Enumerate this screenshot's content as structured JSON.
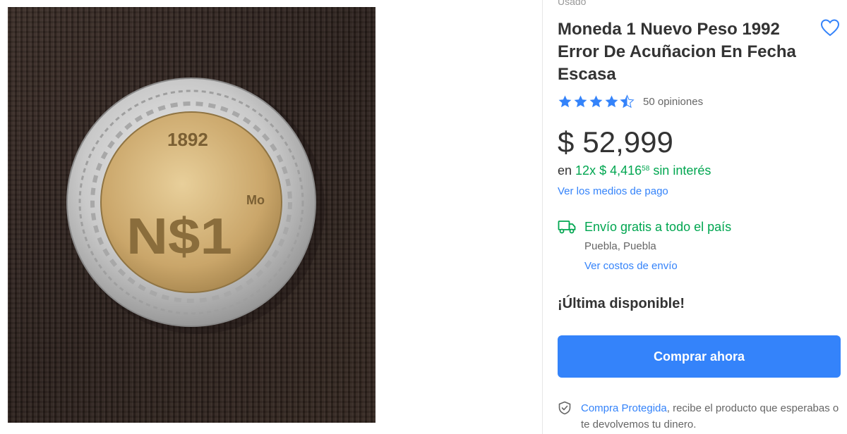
{
  "listing": {
    "condition": "Usado",
    "title": "Moneda 1 Nuevo Peso 1992 Error De Acuñacion En Fecha Escasa",
    "rating": {
      "value": 4.5,
      "max": 5,
      "reviews_label": "50 opiniones"
    },
    "price": {
      "currency": "$",
      "amount": "52,999"
    },
    "installments": {
      "prefix": "en",
      "count": "12x",
      "currency": "$",
      "amount": "4,416",
      "cents": "58",
      "suffix": "sin interés"
    },
    "payment_link": "Ver los medios de pago",
    "shipping": {
      "label": "Envío gratis a todo el país",
      "location": "Puebla, Puebla",
      "cost_link": "Ver costos de envío"
    },
    "stock_label": "¡Última disponible!",
    "buy_button": "Comprar ahora",
    "protection": {
      "link": "Compra Protegida",
      "text": ", recibe el producto que esperabas o te devolvemos tu dinero."
    }
  },
  "photo": {
    "coin_year": "1892",
    "coin_value": "N$1",
    "coin_mint_mark": "Mo"
  },
  "icons": {
    "favorite": "heart-icon",
    "stars": "star-icon",
    "shipping": "truck-icon",
    "protection": "shield-check-icon"
  },
  "colors": {
    "accent": "#3483fa",
    "success": "#00a650",
    "text": "#333333",
    "muted": "#666666"
  }
}
